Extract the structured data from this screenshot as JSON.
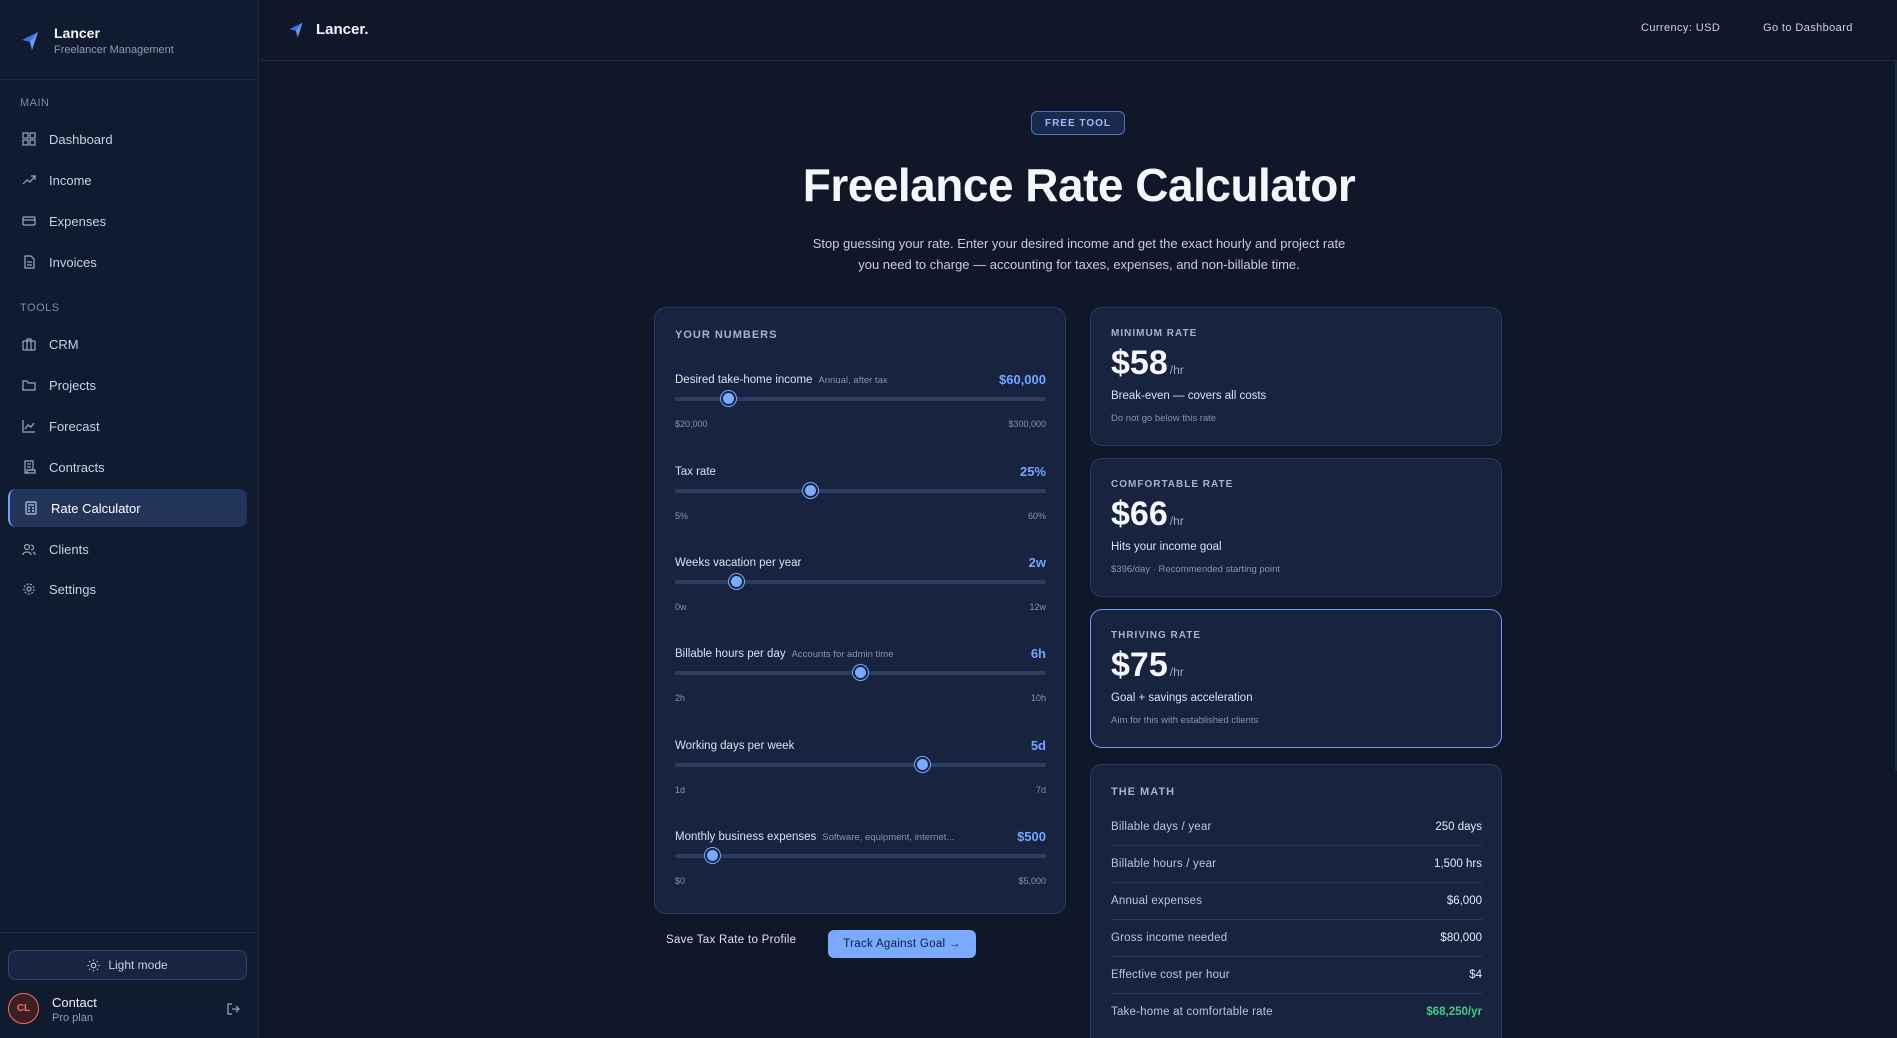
{
  "sidebar": {
    "brand_name": "Lancer",
    "brand_sub": "Freelancer Management",
    "main_label": "MAIN",
    "main_items": [
      {
        "label": "Dashboard",
        "icon": "grid-icon"
      },
      {
        "label": "Income",
        "icon": "trending-up-icon"
      },
      {
        "label": "Expenses",
        "icon": "credit-card-icon"
      },
      {
        "label": "Invoices",
        "icon": "file-icon"
      }
    ],
    "tools_label": "TOOLS",
    "tools_items": [
      {
        "label": "CRM",
        "icon": "briefcase-icon"
      },
      {
        "label": "Projects",
        "icon": "folder-icon"
      },
      {
        "label": "Forecast",
        "icon": "line-chart-icon"
      },
      {
        "label": "Contracts",
        "icon": "scroll-icon"
      },
      {
        "label": "Rate Calculator",
        "icon": "calculator-icon",
        "active": true
      },
      {
        "label": "Clients",
        "icon": "users-icon"
      },
      {
        "label": "Settings",
        "icon": "gear-icon"
      }
    ],
    "light_mode": "Light mode",
    "avatar_initials": "CL",
    "contact_name": "Contact",
    "contact_plan": "Pro plan"
  },
  "topbar": {
    "brand": "Lancer.",
    "currency": "Currency: USD",
    "dashboard_link": "Go to Dashboard"
  },
  "hero": {
    "badge": "FREE TOOL",
    "title": "Freelance Rate Calculator",
    "subtitle_1": "Stop guessing your rate. Enter your desired income and get the exact hourly and project rate",
    "subtitle_2": "you need to charge — accounting for taxes, expenses, and non-billable time."
  },
  "numbers": {
    "title": "YOUR NUMBERS",
    "fields": [
      {
        "label": "Desired take-home income",
        "hint": "Annual, after tax",
        "value": "$60,000",
        "min": "$20,000",
        "max": "$300,000",
        "fraction": 0.143
      },
      {
        "label": "Tax rate",
        "hint": "",
        "value": "25%",
        "min": "5%",
        "max": "60%",
        "fraction": 0.364
      },
      {
        "label": "Weeks vacation per year",
        "hint": "",
        "value": "2w",
        "min": "0w",
        "max": "12w",
        "fraction": 0.167
      },
      {
        "label": "Billable hours per day",
        "hint": "Accounts for admin time",
        "value": "6h",
        "min": "2h",
        "max": "10h",
        "fraction": 0.5
      },
      {
        "label": "Working days per week",
        "hint": "",
        "value": "5d",
        "min": "1d",
        "max": "7d",
        "fraction": 0.667
      },
      {
        "label": "Monthly business expenses",
        "hint": "Software, equipment, internet...",
        "value": "$500",
        "min": "$0",
        "max": "$5,000",
        "fraction": 0.1
      }
    ]
  },
  "actions": {
    "save": "Save Tax Rate to Profile",
    "track": "Track Against Goal →"
  },
  "rates": [
    {
      "label": "MINIMUM RATE",
      "amount": "$58",
      "unit": "/hr",
      "desc": "Break-even — covers all costs",
      "note": "Do not go below this rate"
    },
    {
      "label": "COMFORTABLE RATE",
      "amount": "$66",
      "unit": "/hr",
      "desc": "Hits your income goal",
      "note": "$396/day · Recommended starting point"
    },
    {
      "label": "THRIVING RATE",
      "amount": "$75",
      "unit": "/hr",
      "desc": "Goal + savings acceleration",
      "note": "Aim for this with established clients"
    }
  ],
  "math": {
    "title": "THE MATH",
    "rows": [
      {
        "label": "Billable days / year",
        "value": "250 days"
      },
      {
        "label": "Billable hours / year",
        "value": "1,500 hrs"
      },
      {
        "label": "Annual expenses",
        "value": "$6,000"
      },
      {
        "label": "Gross income needed",
        "value": "$80,000"
      },
      {
        "label": "Effective cost per hour",
        "value": "$4"
      },
      {
        "label": "Take-home at comfortable rate",
        "value": "$68,250/yr"
      }
    ]
  },
  "colors": {
    "accent": "#74a6ff",
    "positive": "#3fd07f",
    "background": "#0f1729"
  }
}
